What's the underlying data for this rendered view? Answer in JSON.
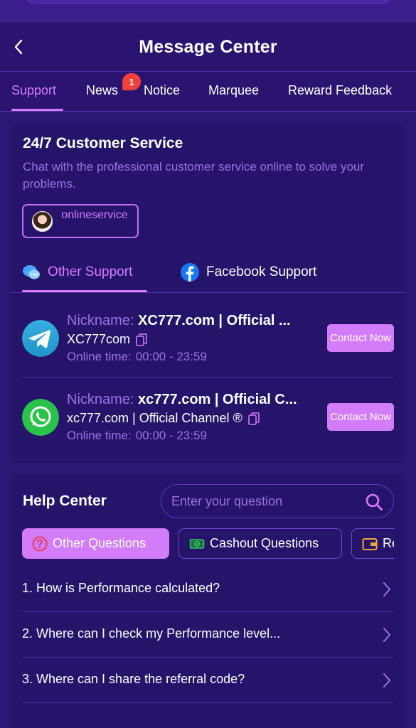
{
  "header": {
    "title": "Message Center"
  },
  "tabs": [
    {
      "label": "Support",
      "active": true
    },
    {
      "label": "News",
      "badge": "1"
    },
    {
      "label": "Notice"
    },
    {
      "label": "Marquee"
    },
    {
      "label": "Reward Feedback"
    }
  ],
  "customer_service": {
    "title": "24/7 Customer Service",
    "description": "Chat with the professional customer service online to solve your problems.",
    "online_button": "onlineservice"
  },
  "support_tabs": [
    {
      "label": "Other Support",
      "icon": "chat-bubbles-icon",
      "active": true
    },
    {
      "label": "Facebook Support",
      "icon": "facebook-icon"
    }
  ],
  "contacts": [
    {
      "icon": "telegram-icon",
      "nickname_label": "Nickname:",
      "nickname": "XC777.com | Official ...",
      "id": "XC777com",
      "online_label": "Online time:",
      "online_time": "00:00 - 23:59",
      "button": "Contact Now"
    },
    {
      "icon": "whatsapp-icon",
      "nickname_label": "Nickname:",
      "nickname": "xc777.com | Official C...",
      "id": "xc777.com | Official Channel ®",
      "online_label": "Online time:",
      "online_time": "00:00 - 23:59",
      "button": "Contact Now"
    }
  ],
  "help_center": {
    "title": "Help Center",
    "search_placeholder": "Enter your question",
    "chips": [
      {
        "label": "Other Questions",
        "icon": "question-circle-icon",
        "active": true
      },
      {
        "label": "Cashout Questions",
        "icon": "cash-icon"
      },
      {
        "label": "Re",
        "icon": "wallet-icon"
      }
    ],
    "faqs": [
      "1. How is Performance calculated?",
      "2. Where can I check my Performance level...",
      "3. Where can I share the referral code?"
    ]
  },
  "colors": {
    "background": "#2c1775",
    "card": "#26136a",
    "accent": "#d77bff",
    "button": "#d27cf9",
    "muted_text": "#9a72e3",
    "badge": "#f0413f"
  }
}
